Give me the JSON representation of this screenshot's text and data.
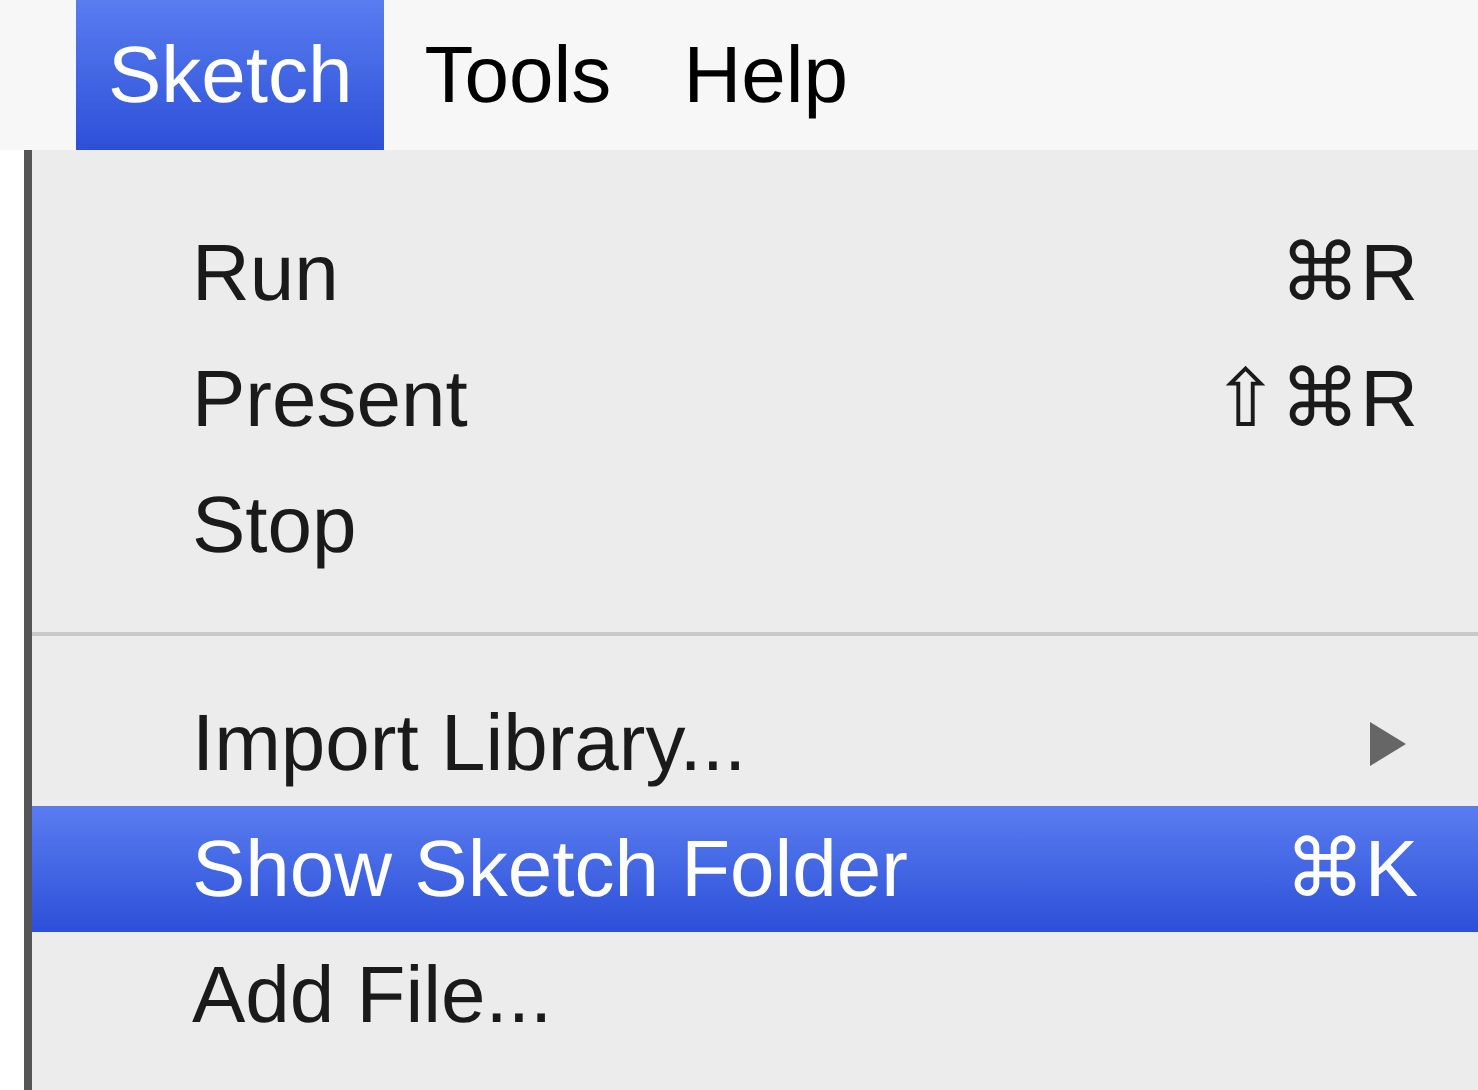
{
  "menu_bar": [
    {
      "label": "Sketch",
      "selected": true
    },
    {
      "label": "Tools",
      "selected": false
    },
    {
      "label": "Help",
      "selected": false
    }
  ],
  "menu": {
    "items": [
      {
        "kind": "item",
        "label": "Run",
        "shortcut": "⌘R",
        "selected": false
      },
      {
        "kind": "item",
        "label": "Present",
        "shortcut": "⇧⌘R",
        "selected": false
      },
      {
        "kind": "item",
        "label": "Stop",
        "selected": false
      },
      {
        "kind": "separator"
      },
      {
        "kind": "submenu",
        "label": "Import Library...",
        "selected": false
      },
      {
        "kind": "item",
        "label": "Show Sketch Folder",
        "shortcut": "⌘K",
        "selected": true
      },
      {
        "kind": "item",
        "label": "Add File...",
        "selected": false
      }
    ]
  }
}
